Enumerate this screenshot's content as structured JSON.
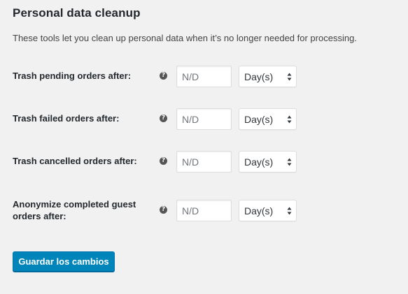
{
  "section": {
    "title": "Personal data cleanup",
    "description": "These tools let you clean up personal data when it’s no longer needed for processing."
  },
  "settings": [
    {
      "label": "Trash pending orders after:",
      "help_icon": "question-mark-icon",
      "input_value": "",
      "input_placeholder": "N/D",
      "unit_selected": "Day(s)"
    },
    {
      "label": "Trash failed orders after:",
      "help_icon": "question-mark-icon",
      "input_value": "",
      "input_placeholder": "N/D",
      "unit_selected": "Day(s)"
    },
    {
      "label": "Trash cancelled orders after:",
      "help_icon": "question-mark-icon",
      "input_value": "",
      "input_placeholder": "N/D",
      "unit_selected": "Day(s)"
    },
    {
      "label": "Anonymize completed guest orders after:",
      "help_icon": "question-mark-icon",
      "input_value": "",
      "input_placeholder": "N/D",
      "unit_selected": "Day(s)"
    }
  ],
  "actions": {
    "save_label": "Guardar los cambios"
  },
  "colors": {
    "background": "#f1f1f1",
    "primary_button": "#0085ba",
    "help_icon": "#555555"
  }
}
